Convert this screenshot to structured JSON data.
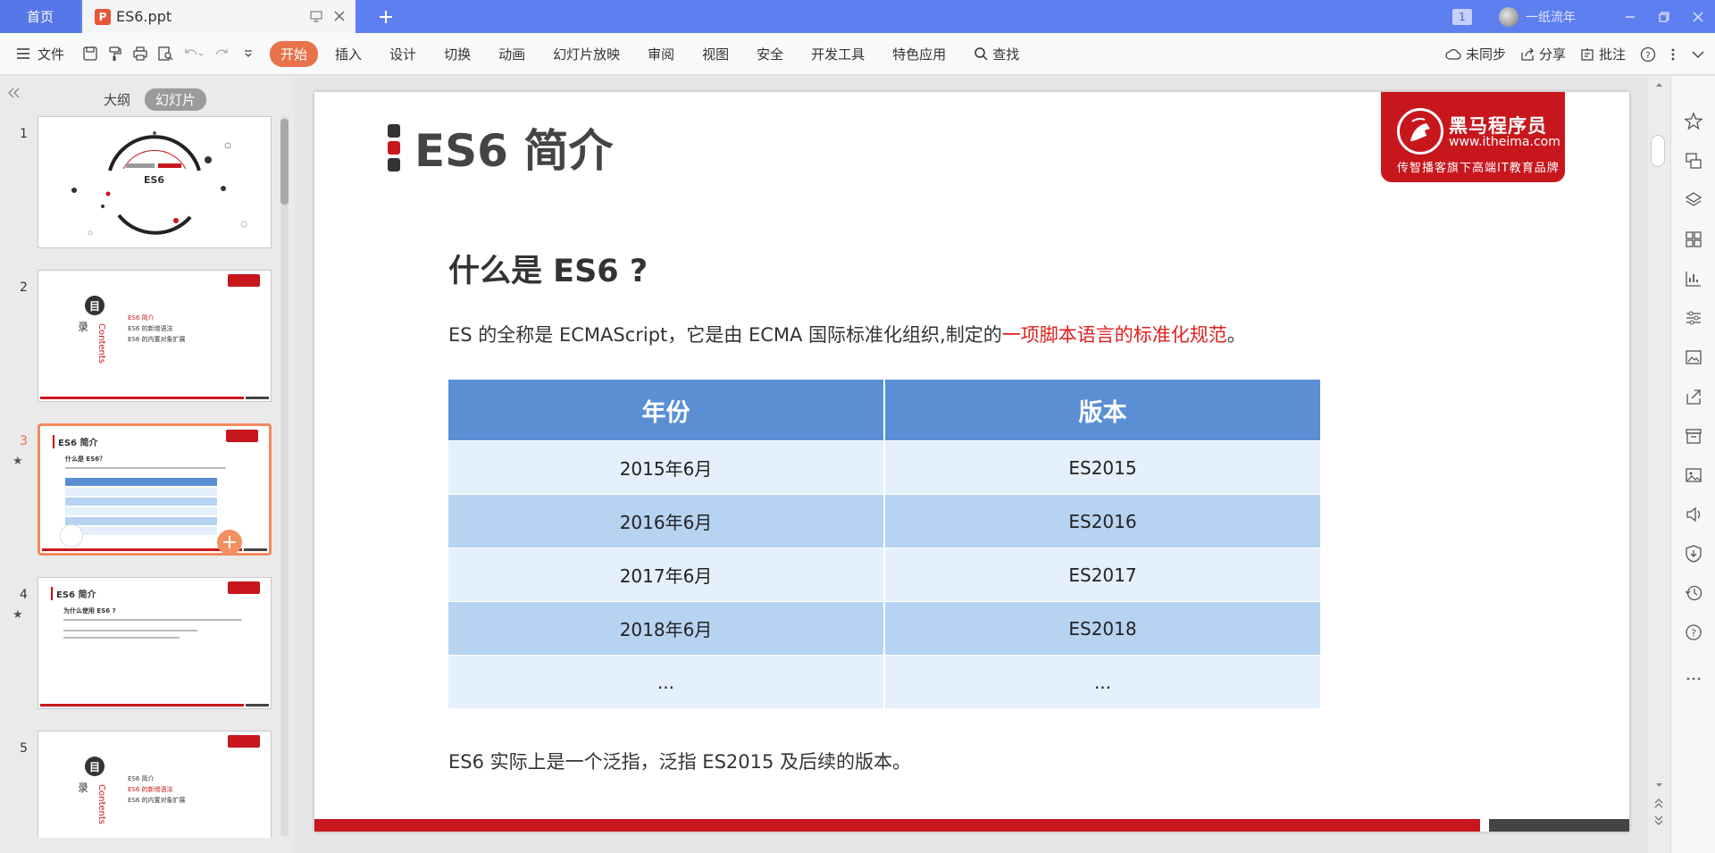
{
  "titlebar": {
    "home_tab": "首页",
    "file_tab": "ES6.ppt",
    "file_badge": "P",
    "window_count": "1",
    "user_name": "一纸流年"
  },
  "ribbon": {
    "file_menu": "文件",
    "tabs": [
      "开始",
      "插入",
      "设计",
      "切换",
      "动画",
      "幻灯片放映",
      "审阅",
      "视图",
      "安全",
      "开发工具",
      "特色应用"
    ],
    "active_tab": "开始",
    "find": "查找",
    "sync": "未同步",
    "share": "分享",
    "comment": "批注"
  },
  "leftpanel": {
    "outline_tab": "大纲",
    "slides_tab": "幻灯片",
    "thumbnails": [
      {
        "num": "1",
        "title": "ES6"
      },
      {
        "num": "2",
        "toc_a": "目",
        "toc_b": "录",
        "contents": "Contents",
        "items": [
          "ES6 简介",
          "ES6 的新增语法",
          "ES6 的内置对象扩展"
        ]
      },
      {
        "num": "3",
        "title": "ES6 简介",
        "sub": "什么是 ES6？"
      },
      {
        "num": "4",
        "title": "ES6 简介",
        "sub": "为什么使用 ES6 ?"
      },
      {
        "num": "5",
        "toc_a": "目",
        "toc_b": "录",
        "contents": "Contents",
        "items": [
          "ES6 简介",
          "ES6 的新增语法",
          "ES6 的内置对象扩展"
        ]
      }
    ]
  },
  "slide": {
    "title": "ES6 简介",
    "logo": {
      "name": "黑马程序员",
      "url": "www.itheima.com",
      "tagline": "传智播客旗下高端IT教育品牌"
    },
    "heading": "什么是 ES6 ?",
    "desc_prefix": "ES 的全称是 ECMAScript，它是由 ECMA 国际标准化组织,制定的",
    "desc_highlight": "一项脚本语言的标准化规范",
    "desc_suffix": "。",
    "table": {
      "headers": [
        "年份",
        "版本"
      ],
      "rows": [
        [
          "2015年6月",
          "ES2015"
        ],
        [
          "2016年6月",
          "ES2016"
        ],
        [
          "2017年6月",
          "ES2017"
        ],
        [
          "2018年6月",
          "ES2018"
        ],
        [
          "...",
          "..."
        ]
      ]
    },
    "note": "ES6 实际上是一个泛指，泛指  ES2015 及后续的版本。"
  },
  "colors": {
    "accent": "#e8724a",
    "titlebar": "#5d7ff0",
    "brand_red": "#c8161d",
    "table_header": "#5b8fd4",
    "row_light": "#e4f0fb",
    "row_dark": "#b7d3f2",
    "highlight": "#e02020"
  }
}
